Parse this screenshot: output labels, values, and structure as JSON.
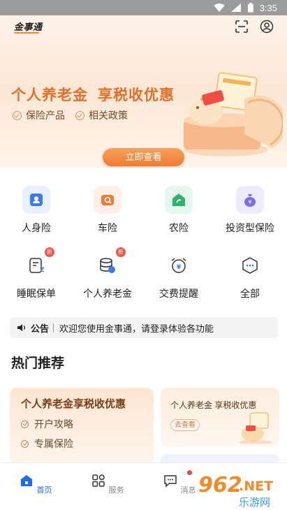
{
  "status_bar": {
    "time": "3:35"
  },
  "header": {
    "app_logo": "金事通"
  },
  "banner": {
    "title_part1": "个人养老金",
    "title_part2": "享税收优惠",
    "features": [
      "保险产品",
      "相关政策"
    ],
    "cta_label": "立即查看"
  },
  "services": [
    {
      "label": "人身险",
      "icon": "person-card-icon",
      "color": "#3a7bf0",
      "bg": "#e9f1ff"
    },
    {
      "label": "车险",
      "icon": "car-icon",
      "color": "#f07a3a",
      "bg": "#fff1e8"
    },
    {
      "label": "农险",
      "icon": "farm-house-icon",
      "color": "#2fb36b",
      "bg": "#e6f7ee"
    },
    {
      "label": "投资型保险",
      "icon": "money-bag-icon",
      "color": "#7b6cf0",
      "bg": "#eeebff"
    },
    {
      "label": "睡眠保单",
      "icon": "sleep-policy-icon",
      "color": "#3a7bf0",
      "bg": "#ffffff",
      "badge": "折"
    },
    {
      "label": "个人养老金",
      "icon": "coins-stack-icon",
      "color": "#3a7bf0",
      "bg": "#ffffff",
      "badge": "折"
    },
    {
      "label": "交费提醒",
      "icon": "alarm-clock-icon",
      "color": "#3a7bf0",
      "bg": "#ffffff"
    },
    {
      "label": "全部",
      "icon": "more-hexagon-icon",
      "color": "#3a7bf0",
      "bg": "#ffffff"
    }
  ],
  "notice": {
    "tag": "公告",
    "text": "欢迎您使用金事通，请登录体验各功能"
  },
  "hot": {
    "title": "热门推荐",
    "card_big": {
      "title": "个人养老金享税收优惠",
      "items": [
        "开户攻略",
        "专属保险"
      ]
    },
    "card_small": {
      "title": "个人养老金 享税收优惠",
      "button": "去查看"
    }
  },
  "tabbar": {
    "tabs": [
      {
        "label": "首页",
        "active": true
      },
      {
        "label": "服务",
        "active": false
      },
      {
        "label": "消息",
        "active": false
      }
    ]
  },
  "watermark": {
    "brand": "962",
    "suffix": ".NET",
    "site": "乐游网"
  },
  "colors": {
    "accent": "#ee7a32",
    "primary": "#1e6cf0",
    "badge": "#f0574a"
  }
}
